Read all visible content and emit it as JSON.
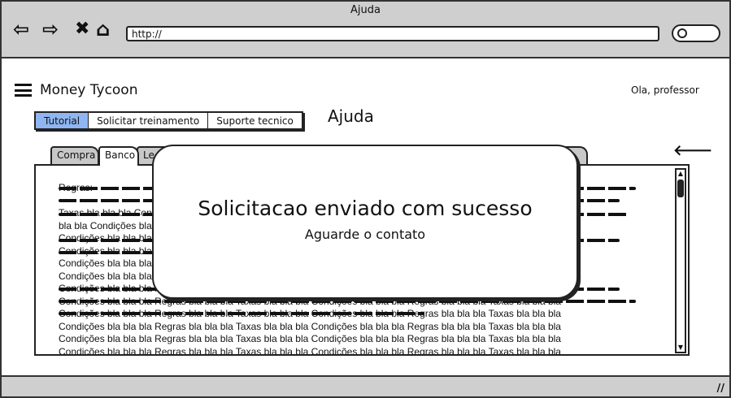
{
  "window": {
    "title": "Ajuda",
    "url": "http://"
  },
  "header": {
    "brand": "Money Tycoon",
    "greeting": "Ola, professor"
  },
  "buttons": [
    {
      "label": "Tutorial",
      "selected": true
    },
    {
      "label": "Solicitar treinamento",
      "selected": false
    },
    {
      "label": "Suporte tecnico",
      "selected": false
    }
  ],
  "page_title": "Ajuda",
  "tabs": [
    {
      "label": "Compra"
    },
    {
      "label": "Banco"
    },
    {
      "label": "Le"
    }
  ],
  "content": {
    "first": "Regras:",
    "lines": [
      "Taxas bla bla bla Condições bla bla bla Regras bla bla bla Taxas bla bla",
      "bla bla Condições bla bla bla Regras bla bla bla Taxas bla bla bla",
      "Condições bla bla bla Regras bla bla bla Taxas bla bla bla",
      "Condições bla bla bla Regras bla bla bla Taxas bla bla bla Condições bla bla bla Regras bla bla bla Taxas bla bla bla",
      "Condições bla bla bla Regras bla bla bla Taxas bla bla bla Condições bla bla bla Regras bla bla bla Taxas bla bla bla",
      "Condições bla bla bla Regras bla bla bla Taxas bla bla bla Condições bla bla bla Regras bla bla bla Taxas bla bla bla",
      "Condições bla bla bla Regras bla bla bla Taxas bla bla bla Condições bla bla bla Regras bla bla bla Taxas bla bla bla",
      "Condições bla bla bla Regras bla bla bla Taxas bla bla bla Condições bla bla bla Regras bla bla bla Taxas bla bla bla",
      "Condições bla bla bla Regras bla bla bla Taxas bla bla bla Condições bla bla bla Regras bla bla bla Taxas bla bla bla",
      "Condições bla bla bla Regras bla bla bla Taxas bla bla bla Condições bla bla bla Regras bla bla bla Taxas bla bla bla",
      "Condições bla bla bla Regras bla bla bla Taxas bla bla bla Condições bla bla bla Regras bla bla bla Taxas bla bla bla",
      "Condições bla bla bla Regras bla bla bla Taxas bla bla bla Condições bla bla bla Regras bla bla bla Taxas bla bla bla"
    ]
  },
  "modal": {
    "title": "Solicitacao enviado com sucesso",
    "subtitle": "Aguarde o contato"
  },
  "icons": {
    "back": "arrow-left-icon",
    "forward": "arrow-right-icon",
    "stop": "close-icon",
    "home": "home-icon",
    "search": "search-icon",
    "menu": "hamburger-icon"
  },
  "colors": {
    "selected": "#8fb6f2",
    "chrome": "#cfcfcf"
  }
}
